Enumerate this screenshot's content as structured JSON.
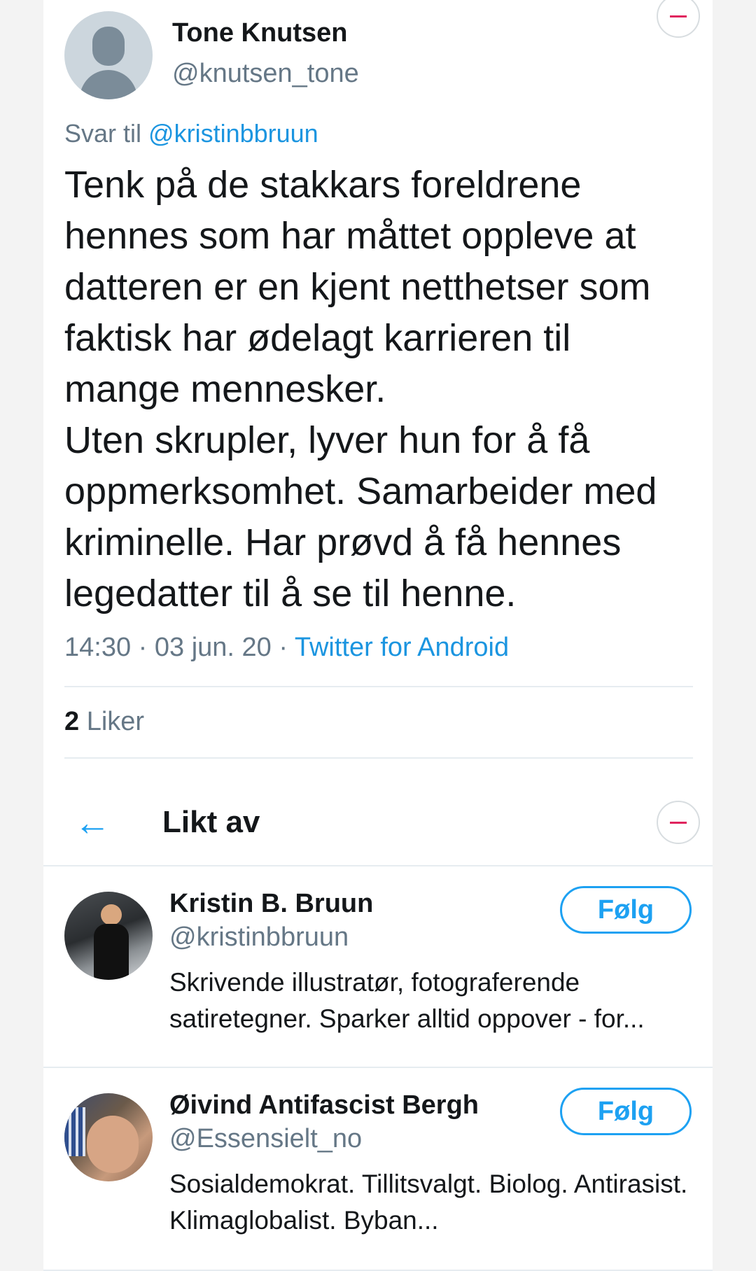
{
  "tweet": {
    "author_name": "Tone Knutsen",
    "author_handle": "@knutsen_tone",
    "reply_prefix": "Svar til",
    "reply_mention": "@kristinbbruun",
    "text": "Tenk på de stakkars foreldrene hennes som har måttet oppleve at datteren er en kjent netthetser som faktisk har ødelagt karrieren til mange mennesker.\nUten skrupler, lyver hun for å få oppmerksomhet. Samarbeider med kriminelle. Har prøvd å få hennes legedatter til å se til henne.",
    "timestamp": "14:30 · 03 jun. 20 · ",
    "client": "Twitter for Android",
    "likes_count": "2",
    "likes_label": " Liker"
  },
  "liked_by": {
    "title": "Likt av",
    "users": [
      {
        "name": "Kristin B. Bruun",
        "handle": "@kristinbbruun",
        "bio": "Skrivende illustratør, fotograferende satiretegner. Sparker alltid oppover - for...",
        "follow_label": "Følg"
      },
      {
        "name": "Øivind Antifascist Bergh",
        "handle": "@Essensielt_no",
        "bio": "Sosialdemokrat. Tillitsvalgt. Biolog. Antirasist. Klimaglobalist. Byban...",
        "follow_label": "Følg"
      }
    ]
  },
  "colors": {
    "accent": "#1da1f2",
    "link": "#1b95e0",
    "collapse_minus": "#e0245e",
    "secondary_text": "#657786"
  },
  "icons": {
    "back": "arrow-left-icon",
    "collapse": "minus-circle-icon",
    "avatar_default": "default-avatar-icon"
  }
}
